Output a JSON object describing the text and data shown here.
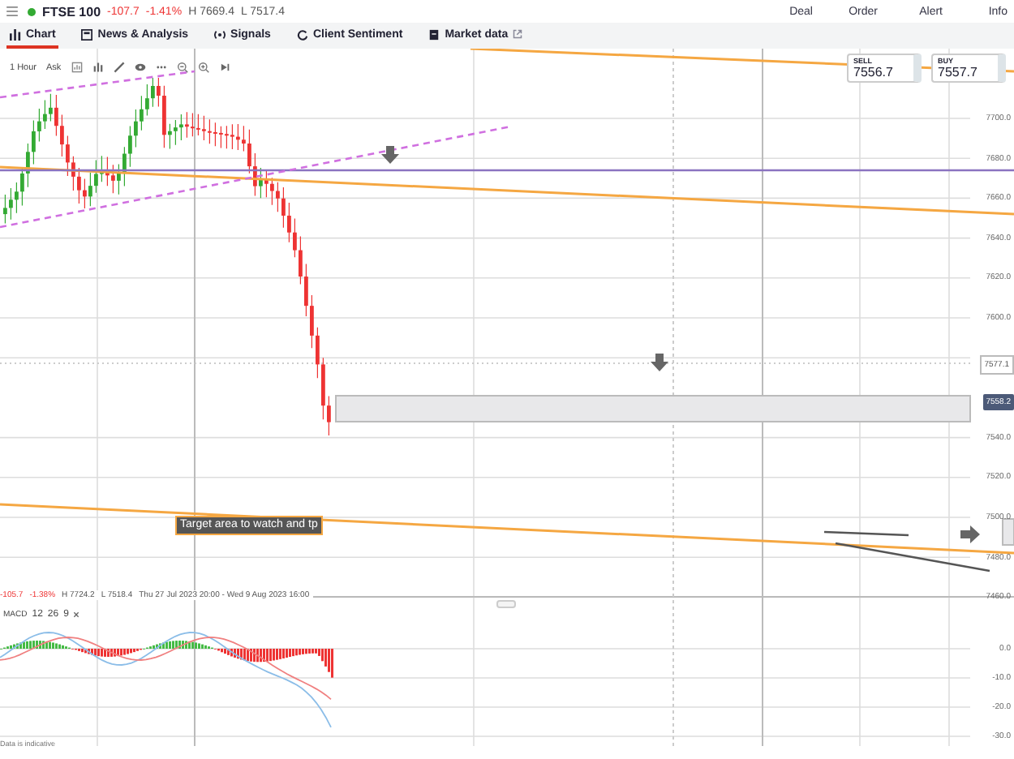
{
  "header": {
    "symbol": "FTSE 100",
    "change": "-107.7",
    "change_pct": "-1.41%",
    "high": "H 7669.4",
    "low": "L 7517.4",
    "actions": [
      "Deal",
      "Order",
      "Alert",
      "Info"
    ]
  },
  "tabs": [
    {
      "label": "Chart",
      "selected": true
    },
    {
      "label": "News & Analysis",
      "selected": false
    },
    {
      "label": "Signals",
      "selected": false
    },
    {
      "label": "Client Sentiment",
      "selected": false
    },
    {
      "label": "Market data",
      "external": true,
      "selected": false
    }
  ],
  "toolbar": {
    "timeframe": "1 Hour",
    "price_type": "Ask"
  },
  "quotes": [
    {
      "label": "SELL",
      "price": "7556.7"
    },
    {
      "label": "BUY",
      "price": "7557.7"
    }
  ],
  "price_axis_upper": [
    "7700.0",
    "7680.0",
    "7660.0",
    "7640.0",
    "7620.0",
    "7600.0"
  ],
  "price_axis_lower": [
    "7540.0",
    "7520.0",
    "7500.0",
    "7480.0",
    "7460.0"
  ],
  "price_markers": [
    {
      "kind": "price_line",
      "label": "7577.1"
    },
    {
      "kind": "current_price",
      "label": "7558.2"
    }
  ],
  "annotation": "Target area to watch and tp",
  "summary": {
    "change": "-105.7",
    "change_pct": "-1.38%",
    "high": "H 7724.2",
    "low": "L 7518.4",
    "range": "Thu 27 Jul 2023 20:00 - Wed 9 Aug 2023 16:00"
  },
  "indicator": {
    "name": "MACD",
    "params": [
      "12",
      "26",
      "9"
    ]
  },
  "macd_axis": [
    "0.0",
    "-10.0",
    "-20.0",
    "-30.0"
  ],
  "footnote": "Data is indicative"
}
